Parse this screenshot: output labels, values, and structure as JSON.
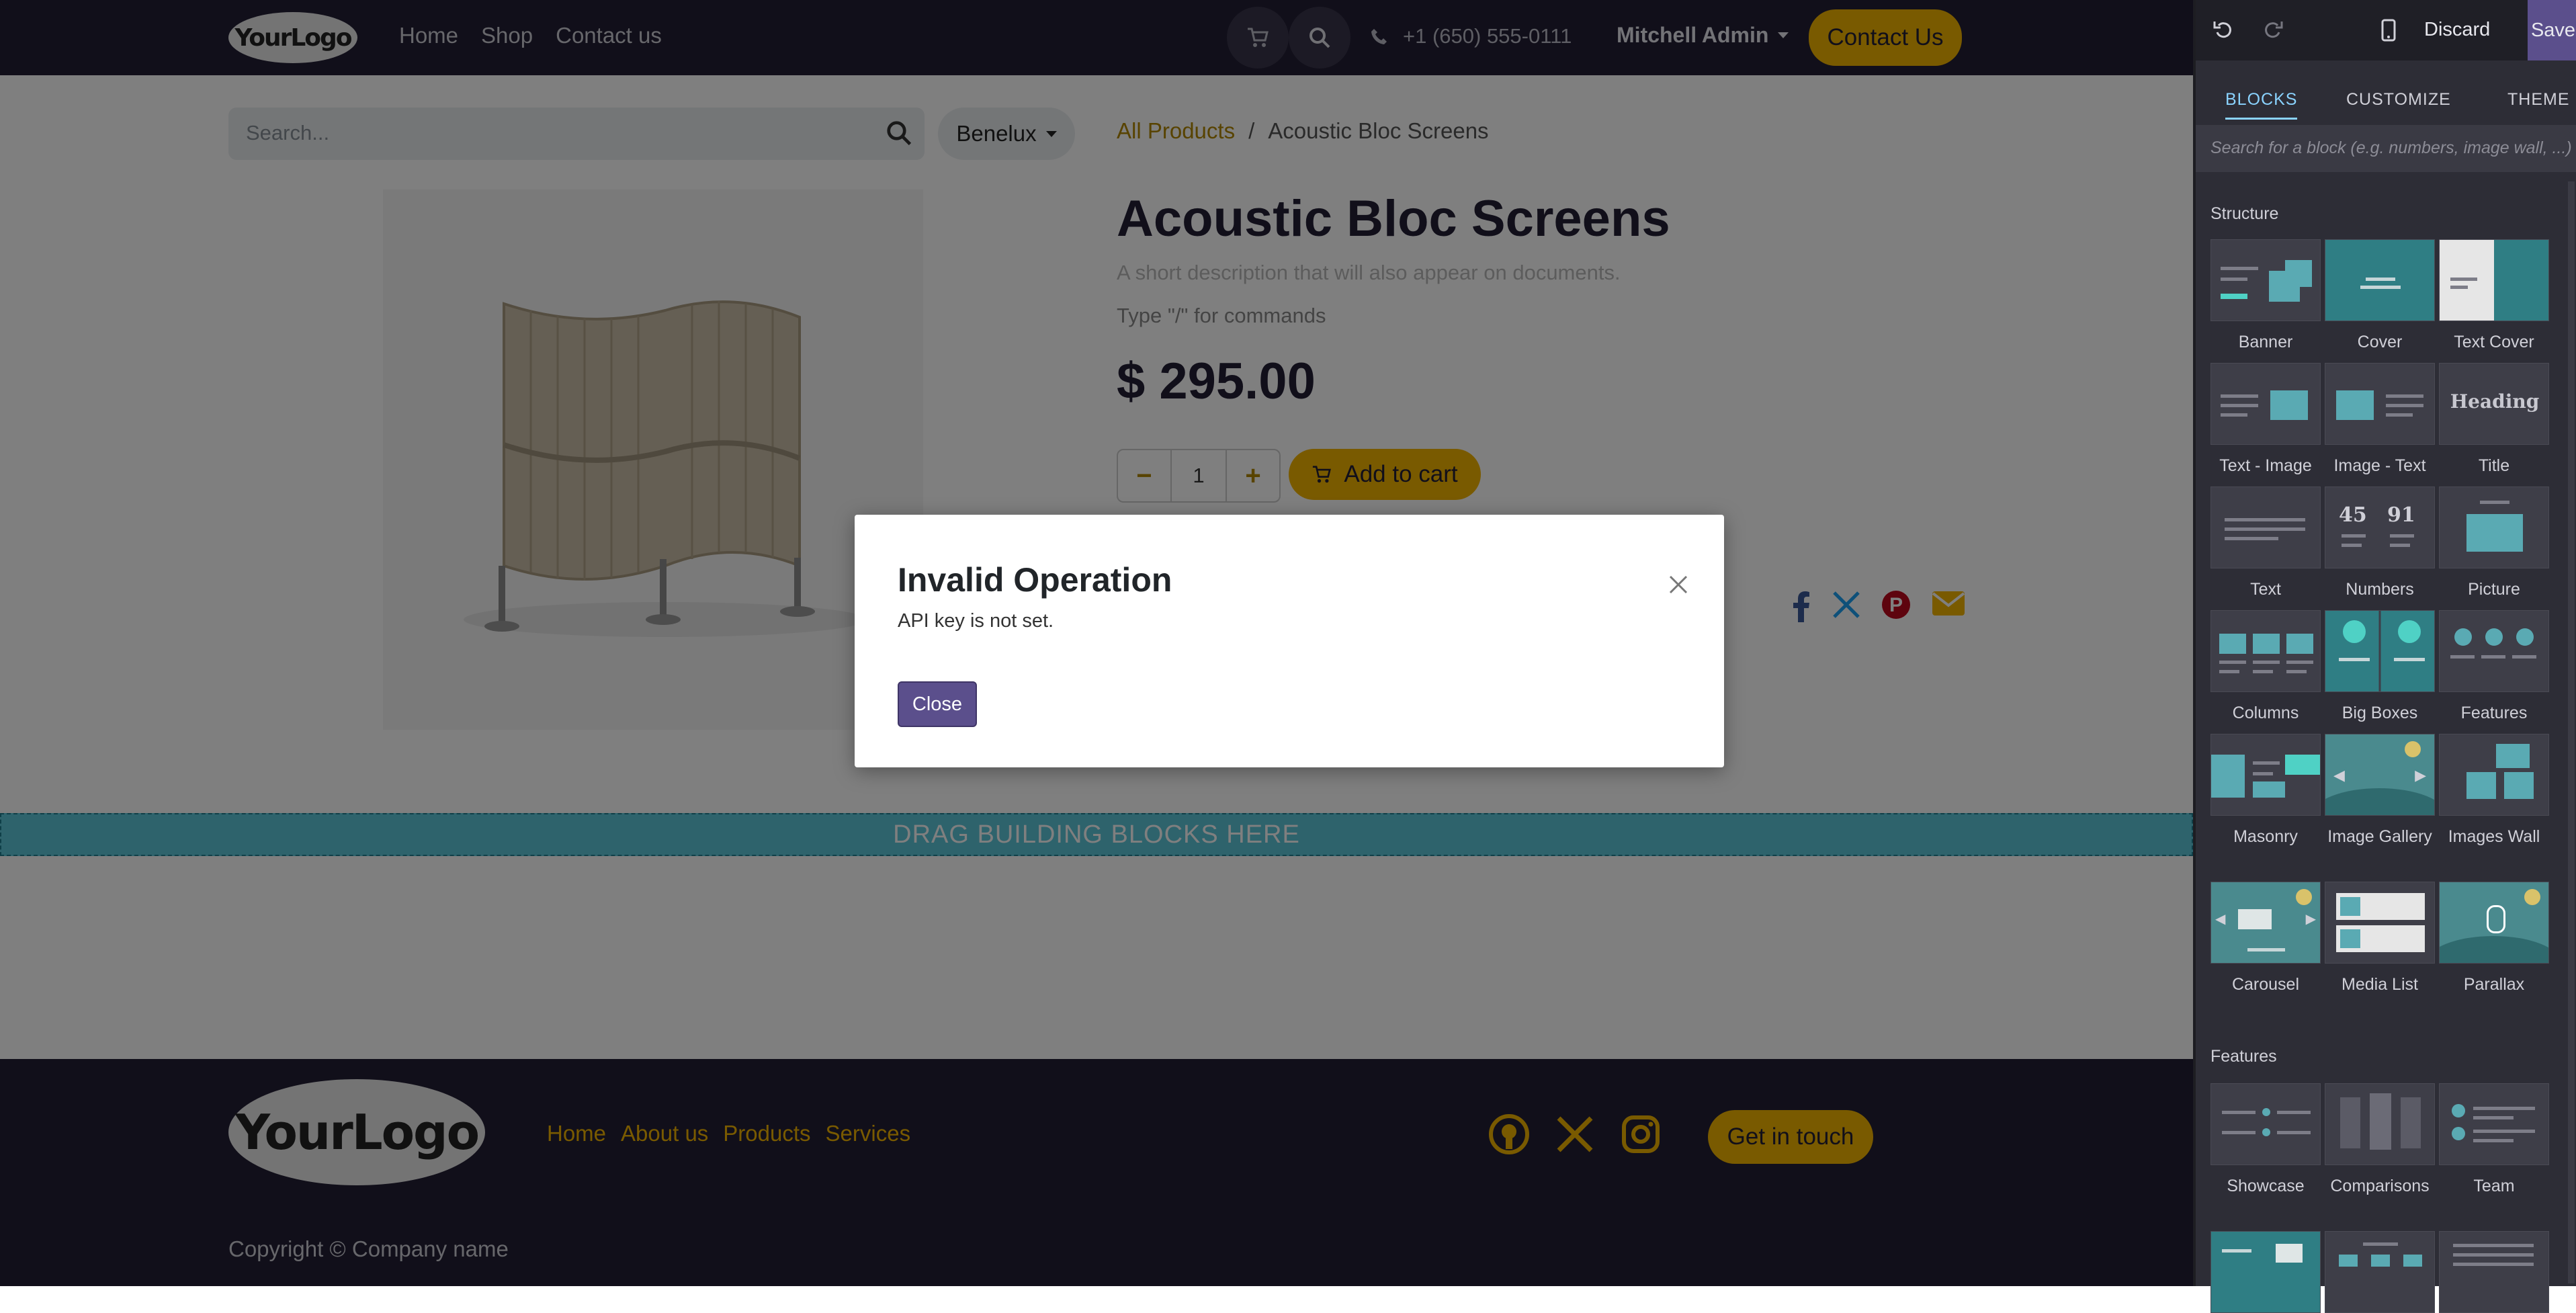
{
  "header": {
    "logo_text": "YourLogo",
    "nav": [
      "Home",
      "Shop",
      "Contact us"
    ],
    "phone": "+1 (650) 555-0111",
    "user": "Mitchell Admin",
    "contact_button": "Contact Us"
  },
  "product_page": {
    "search_placeholder": "Search...",
    "pricelist": "Benelux",
    "breadcrumb": [
      "All Products",
      "/",
      "Acoustic Bloc Screens"
    ],
    "title": "Acoustic Bloc Screens",
    "short_description": "A short description that will also appear on documents.",
    "command_hint": "Type \"/\" for commands",
    "price": "$ 295.00",
    "quantity": "1",
    "add_to_cart": "Add to cart",
    "drop_zone": "DRAG BUILDING BLOCKS HERE"
  },
  "footer": {
    "logo_text": "YourLogo",
    "nav": [
      "Home",
      "About us",
      "Products",
      "Services"
    ],
    "cta": "Get in touch",
    "copyright": "Copyright © Company name"
  },
  "modal": {
    "title": "Invalid Operation",
    "body": "API key is not set.",
    "close_button": "Close"
  },
  "editor": {
    "discard": "Discard",
    "save": "Save",
    "tabs": [
      "BLOCKS",
      "CUSTOMIZE",
      "THEME"
    ],
    "search_placeholder": "Search for a block (e.g. numbers, image wall, ...)",
    "sections": {
      "structure": {
        "title": "Structure",
        "blocks": [
          "Banner",
          "Cover",
          "Text Cover",
          "Text - Image",
          "Image - Text",
          "Title",
          "Text",
          "Numbers",
          "Picture",
          "Columns",
          "Big Boxes",
          "Features",
          "Masonry",
          "Image Gallery",
          "Images Wall",
          "Carousel",
          "Media List",
          "Parallax"
        ]
      },
      "features": {
        "title": "Features",
        "blocks": [
          "Showcase",
          "Comparisons",
          "Team"
        ]
      }
    },
    "thumb_text": {
      "heading": "Heading",
      "numbers_a": "45",
      "numbers_b": "91"
    }
  },
  "colors": {
    "brand_dark": "#231f35",
    "accent": "#f3b400",
    "primary_button": "#5b4f8c",
    "editor_bg": "#2d2d36"
  }
}
